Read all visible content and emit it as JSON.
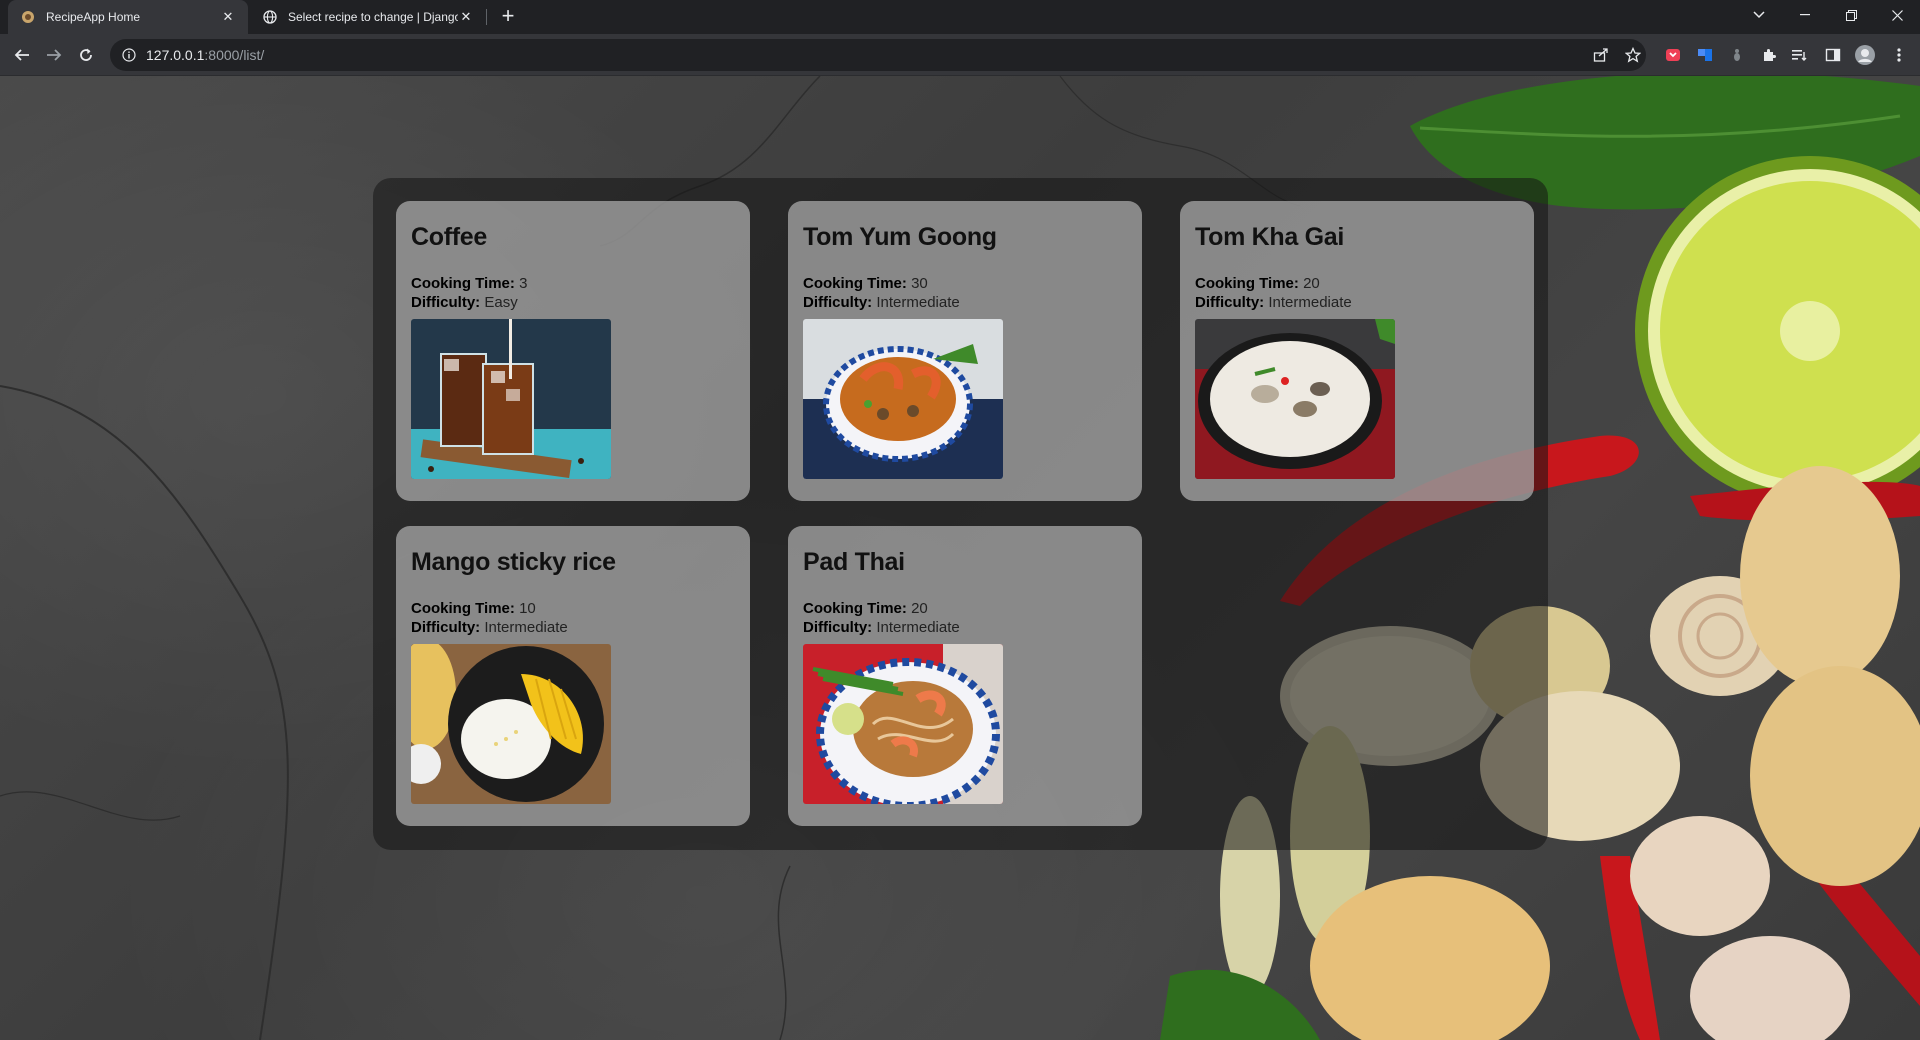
{
  "browser": {
    "tabs": [
      {
        "title": "RecipeApp Home",
        "active": true
      },
      {
        "title": "Select recipe to change | Django",
        "active": false
      }
    ],
    "url_host": "127.0.0.1",
    "url_rest": ":8000/list/",
    "icons": {
      "back": "arrow-left-icon",
      "forward": "arrow-right-icon",
      "reload": "reload-icon",
      "share": "share-icon",
      "bookmark": "star-icon",
      "extensions": "puzzle-icon",
      "menu": "kebab-menu-icon"
    }
  },
  "recipes": [
    {
      "name": "Coffee",
      "time_label": "Cooking Time:",
      "time": "3",
      "difficulty_label": "Difficulty:",
      "difficulty": "Easy",
      "image": "iced-coffee-photo"
    },
    {
      "name": "Tom Yum Goong",
      "time_label": "Cooking Time:",
      "time": "30",
      "difficulty_label": "Difficulty:",
      "difficulty": "Intermediate",
      "image": "tom-yum-soup-photo"
    },
    {
      "name": "Tom Kha Gai",
      "time_label": "Cooking Time:",
      "time": "20",
      "difficulty_label": "Difficulty:",
      "difficulty": "Intermediate",
      "image": "tom-kha-soup-photo"
    },
    {
      "name": "Mango sticky rice",
      "time_label": "Cooking Time:",
      "time": "10",
      "difficulty_label": "Difficulty:",
      "difficulty": "Intermediate",
      "image": "mango-sticky-rice-photo"
    },
    {
      "name": "Pad Thai",
      "time_label": "Cooking Time:",
      "time": "20",
      "difficulty_label": "Difficulty:",
      "difficulty": "Intermediate",
      "image": "pad-thai-photo"
    }
  ],
  "colors": {
    "chrome_dark": "#202124",
    "chrome_toolbar": "#35363a",
    "card_bg": "#afafaf",
    "container_bg": "#141414"
  }
}
